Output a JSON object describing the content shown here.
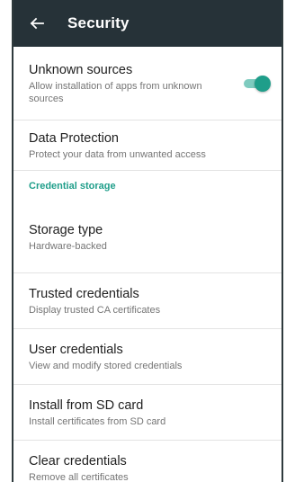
{
  "appbar": {
    "title": "Security",
    "back_icon": "arrow-left-icon"
  },
  "items": {
    "unknown_sources": {
      "title": "Unknown sources",
      "summary": "Allow installation of apps from unknown sources",
      "toggle_on": true
    },
    "data_protection": {
      "title": "Data Protection",
      "summary": "Protect your data from unwanted access"
    },
    "section": {
      "label": "Credential storage"
    },
    "storage_type": {
      "title": "Storage type",
      "summary": "Hardware-backed"
    },
    "trusted_credentials": {
      "title": "Trusted credentials",
      "summary": "Display trusted CA certificates"
    },
    "user_credentials": {
      "title": "User credentials",
      "summary": "View and modify stored credentials"
    },
    "install_sd": {
      "title": "Install from SD card",
      "summary": "Install certificates from SD card"
    },
    "clear_credentials": {
      "title": "Clear credentials",
      "summary": "Remove all certificates"
    }
  },
  "colors": {
    "appbar": "#263238",
    "accent": "#1f9e8a"
  }
}
